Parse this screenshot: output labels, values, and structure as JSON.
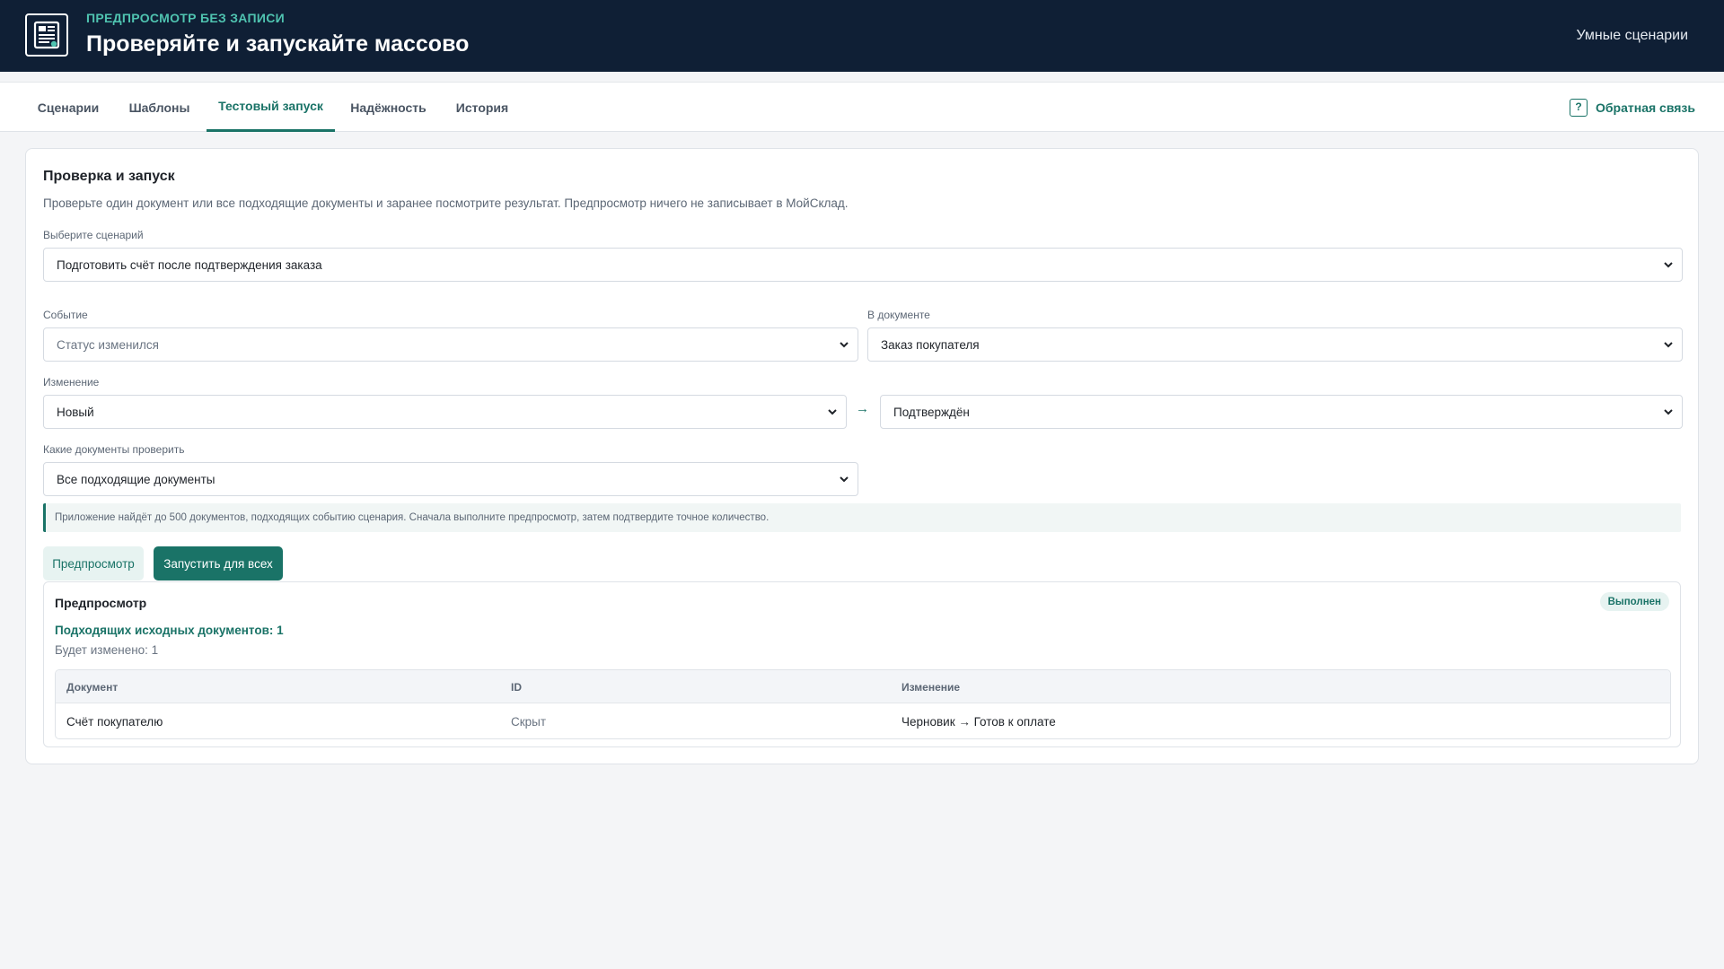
{
  "header": {
    "kicker": "ПРЕДПРОСМОТР БЕЗ ЗАПИСИ",
    "title": "Проверяйте и запускайте массово",
    "app_name": "Умные сценарии",
    "logo_icon": "document-stack-icon"
  },
  "nav": {
    "tabs": [
      {
        "label": "Сценарии",
        "active": false
      },
      {
        "label": "Шаблоны",
        "active": false
      },
      {
        "label": "Тестовый запуск",
        "active": true
      },
      {
        "label": "Надёжность",
        "active": false
      },
      {
        "label": "История",
        "active": false
      }
    ],
    "feedback_icon_glyph": "?",
    "feedback_label": "Обратная связь"
  },
  "form": {
    "title": "Проверка и запуск",
    "subtitle": "Проверьте один документ или все подходящие документы и заранее посмотрите результат. Предпросмотр ничего не записывает в МойСклад.",
    "scenario_label": "Выберите сценарий",
    "scenario_value": "Подготовить счёт после подтверждения заказа",
    "event_label": "Событие",
    "event_value": "Статус изменился",
    "document_label": "В документе",
    "document_value": "Заказ покупателя",
    "change_label": "Изменение",
    "change_from": "Новый",
    "change_arrow": "→",
    "change_to": "Подтверждён",
    "docs_label": "Какие документы проверить",
    "docs_value": "Все подходящие документы",
    "info_note": "Приложение найдёт до 500 документов, подходящих событию сценария. Сначала выполните предпросмотр, затем подтвердите точное количество.",
    "preview_button": "Предпросмотр",
    "run_button": "Запустить для всех"
  },
  "preview": {
    "title": "Предпросмотр",
    "status_badge": "Выполнен",
    "matches": "Подходящих исходных документов: 1",
    "will_change": "Будет изменено: 1",
    "table": {
      "headers": [
        "Документ",
        "ID",
        "Изменение"
      ],
      "rows": [
        [
          "Счёт покупателю",
          "Скрыт",
          "Черновик → Готов к оплате"
        ]
      ]
    }
  },
  "colors": {
    "header_bg": "#0f1f35",
    "accent": "#1a7367",
    "kicker": "#4fc3b0",
    "page_bg": "#f4f5f7"
  }
}
